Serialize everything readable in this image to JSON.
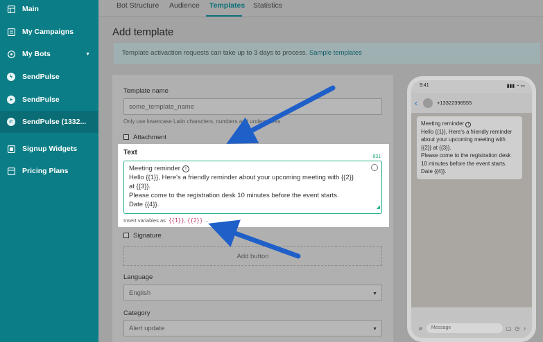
{
  "sidebar": {
    "items": [
      {
        "label": "Main",
        "icon": "grid-icon"
      },
      {
        "label": "My Campaigns",
        "icon": "campaigns-icon"
      },
      {
        "label": "My Bots",
        "icon": "bots-icon"
      },
      {
        "label": "SendPulse",
        "icon": "messenger-icon"
      },
      {
        "label": "SendPulse",
        "icon": "telegram-icon"
      },
      {
        "label": "SendPulse (1332...",
        "icon": "whatsapp-icon"
      },
      {
        "label": "Signup Widgets",
        "icon": "widgets-icon"
      },
      {
        "label": "Pricing Plans",
        "icon": "pricing-icon"
      }
    ]
  },
  "tabs": [
    "Bot Structure",
    "Audience",
    "Templates",
    "Statistics"
  ],
  "page": {
    "title": "Add template",
    "notice": "Template activaction requests can take up to 3 days to process.",
    "notice_link": "Sample templates"
  },
  "form": {
    "name_label": "Template name",
    "name_placeholder": "some_template_name",
    "name_hint": "Only use lowercase Latin characters, numbers and underscores",
    "attachment_label": "Attachment",
    "text_label": "Text",
    "char_count": "831",
    "text_lines": [
      "Meeting reminder",
      "Hello {{1}}, Here's a friendly reminder about your upcoming meeting with {{2}}",
      "at {{3}}.",
      "Please come to the registration desk 10 minutes before the event starts.",
      "Date {{4}}."
    ],
    "vars_prefix": "Insert variables as",
    "var1": "{{1}}",
    "var_sep": ",",
    "var2": "{{2}}",
    "vars_suffix": "...",
    "signature_label": "Signature",
    "add_button": "Add button",
    "language_label": "Language",
    "language_value": "English",
    "category_label": "Category",
    "category_value": "Alert update"
  },
  "phone": {
    "time": "9:41",
    "contact": "+13322396555",
    "bubble_lines": [
      "Meeting reminder",
      "Hello {{1}}, Here's a friendly reminder",
      "about your upcoming meeting with",
      "{{2}} at {{3}}.",
      "Please come to the registration desk",
      "10 minutes before the event starts.",
      "Date {{4}}."
    ],
    "message_placeholder": "Message"
  },
  "colors": {
    "sidebar": "#0b7d86",
    "accent": "#0b6f78",
    "text_border": "#28b08c",
    "arrow": "#1f5fc8"
  }
}
